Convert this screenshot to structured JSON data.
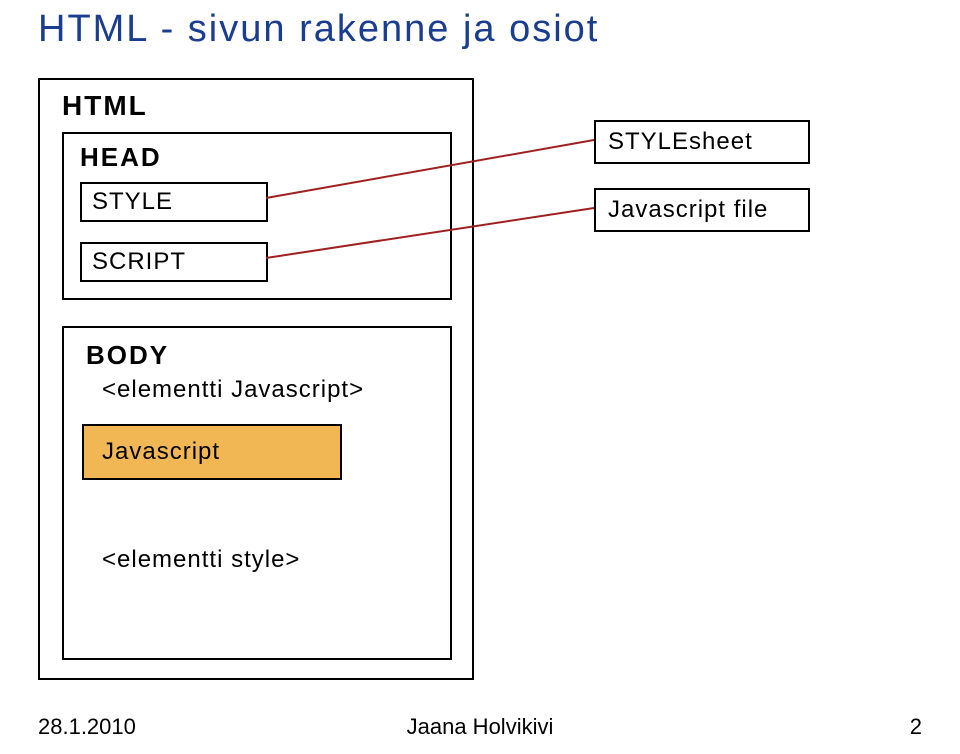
{
  "title": "HTML - sivun rakenne ja osiot",
  "html_label": "HTML",
  "head_label": "HEAD",
  "style_label": "STYLE",
  "script_label": "SCRIPT",
  "body_label": "BODY",
  "elem_js": "<elementti Javascript>",
  "js_box": "Javascript",
  "elem_style": "<elementti style>",
  "stylesheet": "STYLEsheet",
  "jsfile": "Javascript file",
  "footer": {
    "date": "28.1.2010",
    "author": "Jaana Holvikivi",
    "page": "2"
  }
}
